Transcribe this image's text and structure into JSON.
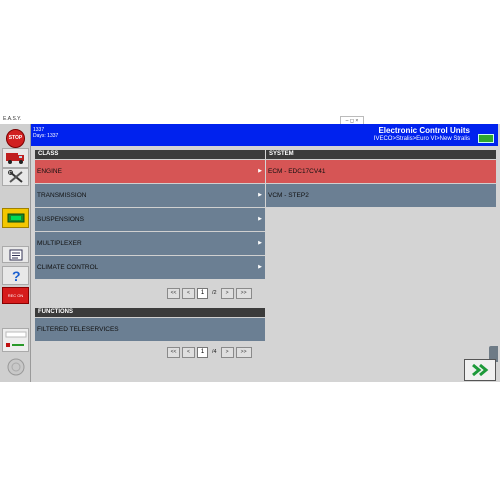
{
  "window": {
    "title": "E.A.S.Y.",
    "controls": "– ◻ ×"
  },
  "header": {
    "left_line1": "1337",
    "left_line2": "Days: 1337",
    "title": "Electronic Control Units",
    "path": "IVECO>Stralis>Euro VI>New Stralis"
  },
  "toolbar": {
    "stop_label": "STOP",
    "rec_label": "REC ON"
  },
  "class_panel": {
    "title": "CLASS",
    "items": [
      {
        "label": "ENGINE",
        "selected": true
      },
      {
        "label": "TRANSMISSION",
        "selected": false
      },
      {
        "label": "SUSPENSIONS",
        "selected": false
      },
      {
        "label": "MULTIPLEXER",
        "selected": false
      },
      {
        "label": "CLIMATE CONTROL",
        "selected": false
      }
    ],
    "pager": {
      "first": "<<",
      "prev": "<",
      "page": "1",
      "total": "/2",
      "next": ">",
      "last": ">>"
    }
  },
  "system_panel": {
    "title": "SYSTEM",
    "items": [
      {
        "label": "ECM - EDC17CV41",
        "selected": true
      },
      {
        "label": "VCM - STEP2",
        "selected": false
      }
    ]
  },
  "functions_panel": {
    "title": "FUNCTIONS",
    "items": [
      {
        "label": "FILTERED TELESERVICES",
        "selected": false
      }
    ],
    "pager": {
      "first": "<<",
      "prev": "<",
      "page": "1",
      "total": "/4",
      "next": ">",
      "last": ">>"
    }
  },
  "colors": {
    "header_blue": "#0022ee",
    "row_slate": "#6b7f93",
    "row_selected": "#d65555",
    "next_green": "#1d9a3a"
  },
  "icons": {
    "next": "double-chevron-right-icon",
    "stop": "stop-icon",
    "truck": "truck-icon",
    "tools": "tools-icon",
    "ecu": "ecu-icon",
    "help": "help-icon"
  }
}
